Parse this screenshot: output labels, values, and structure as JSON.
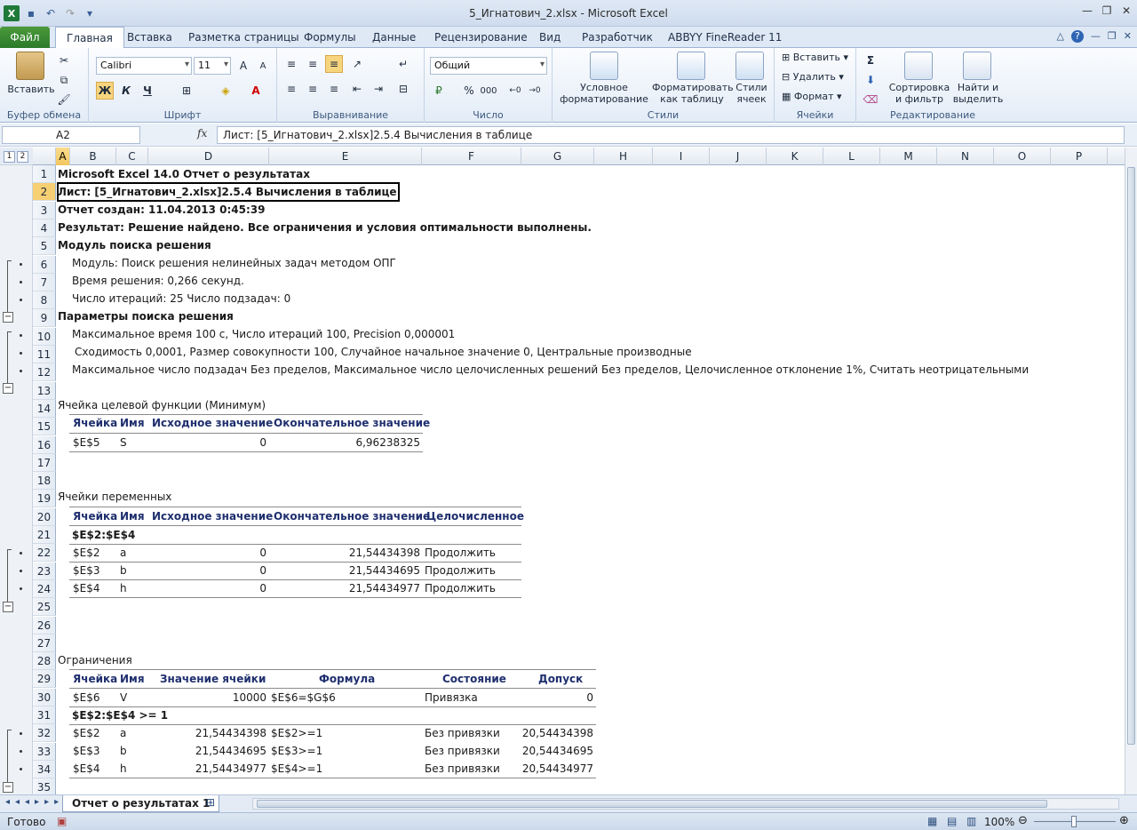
{
  "window": {
    "title": "5_Игнатович_2.xlsx  -  Microsoft Excel"
  },
  "tabs": {
    "file": "Файл",
    "items": [
      "Главная",
      "Вставка",
      "Разметка страницы",
      "Формулы",
      "Данные",
      "Рецензирование",
      "Вид",
      "Разработчик",
      "ABBYY FineReader 11"
    ]
  },
  "ribbon": {
    "clipboard": {
      "paste": "Вставить",
      "label": "Буфер обмена"
    },
    "font": {
      "name": "Calibri",
      "size": "11",
      "bold": "Ж",
      "italic": "К",
      "underline": "Ч",
      "label": "Шрифт"
    },
    "alignment": {
      "label": "Выравнивание"
    },
    "number": {
      "format": "Общий",
      "percent": "%",
      "thousands": "000",
      "label": "Число"
    },
    "styles": {
      "conditional": "Условное форматирование",
      "format_table": "Форматировать как таблицу",
      "cell_styles": "Стили ячеек",
      "label": "Стили"
    },
    "cells": {
      "insert": "Вставить",
      "delete": "Удалить",
      "format": "Формат",
      "label": "Ячейки"
    },
    "editing": {
      "sort": "Сортировка и фильтр",
      "find": "Найти и выделить",
      "label": "Редактирование"
    }
  },
  "formula_bar": {
    "name_box": "A2",
    "fx": "fx",
    "formula": "Лист: [5_Игнатович_2.xlsx]2.5.4 Вычисления в таблице"
  },
  "outline_levels": [
    "1",
    "2"
  ],
  "columns": [
    "A",
    "B",
    "C",
    "D",
    "E",
    "F",
    "G",
    "H",
    "I",
    "J",
    "K",
    "L",
    "M",
    "N",
    "O",
    "P"
  ],
  "rows": [
    "1",
    "2",
    "3",
    "4",
    "5",
    "6",
    "7",
    "8",
    "9",
    "10",
    "11",
    "12",
    "13",
    "14",
    "15",
    "16",
    "17",
    "18",
    "19",
    "20",
    "21",
    "22",
    "23",
    "24",
    "25",
    "26",
    "27",
    "28",
    "29",
    "30",
    "31",
    "32",
    "33",
    "34",
    "35"
  ],
  "report": {
    "r1": "Microsoft Excel 14.0 Отчет о результатах",
    "r2": "Лист: [5_Игнатович_2.xlsx]2.5.4 Вычисления в таблице",
    "r3": "Отчет создан: 11.04.2013 0:45:39",
    "r4": "Результат: Решение найдено. Все ограничения и условия оптимальности выполнены.",
    "r5": "Модуль поиска решения",
    "r6": "Модуль: Поиск решения нелинейных задач методом ОПГ",
    "r7": "Время решения: 0,266 секунд.",
    "r8": "Число итераций: 25 Число подзадач: 0",
    "r9": "Параметры поиска решения",
    "r10": "Максимальное время 100 с,  Число итераций 100, Precision 0,000001",
    "r11": "Сходимость 0,0001, Размер совокупности 100, Случайное начальное значение 0, Центральные производные",
    "r12": "Максимальное число подзадач Без пределов, Максимальное число целочисленных решений Без пределов, Целочисленное отклонение 1%, Считать неотрицательными",
    "r14": "Ячейка целевой функции (Минимум)",
    "r19": "Ячейки переменных",
    "r28": "Ограничения"
  },
  "objective_table": {
    "headers": [
      "Ячейка",
      "Имя",
      "Исходное значение",
      "Окончательное значение"
    ],
    "rows": [
      [
        "$E$5",
        "S",
        "0",
        "6,96238325"
      ]
    ]
  },
  "variables_table": {
    "headers": [
      "Ячейка",
      "Имя",
      "Исходное значение",
      "Окончательное значение",
      "Целочисленное"
    ],
    "group": "$E$2:$E$4",
    "rows": [
      [
        "$E$2",
        "a",
        "0",
        "21,54434398",
        "Продолжить"
      ],
      [
        "$E$3",
        "b",
        "0",
        "21,54434695",
        "Продолжить"
      ],
      [
        "$E$4",
        "h",
        "0",
        "21,54434977",
        "Продолжить"
      ]
    ]
  },
  "constraints_table": {
    "headers": [
      "Ячейка",
      "Имя",
      "Значение ячейки",
      "Формула",
      "Состояние",
      "Допуск"
    ],
    "row30": [
      "$E$6",
      "V",
      "10000",
      "$E$6=$G$6",
      "Привязка",
      "0"
    ],
    "group": "$E$2:$E$4 >= 1",
    "rows": [
      [
        "$E$2",
        "a",
        "21,54434398",
        "$E$2>=1",
        "Без привязки",
        "20,54434398"
      ],
      [
        "$E$3",
        "b",
        "21,54434695",
        "$E$3>=1",
        "Без привязки",
        "20,54434695"
      ],
      [
        "$E$4",
        "h",
        "21,54434977",
        "$E$4>=1",
        "Без привязки",
        "20,54434977"
      ]
    ]
  },
  "sheet_tab": "Отчет о результатах 1",
  "status": {
    "ready": "Готово",
    "zoom": "100%"
  }
}
